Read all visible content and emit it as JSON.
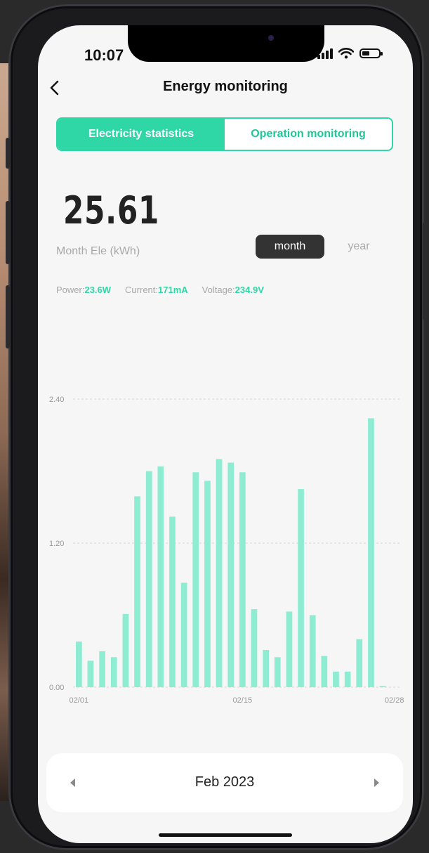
{
  "status": {
    "time": "10:07"
  },
  "header": {
    "title": "Energy monitoring",
    "back_icon": "chevron-left-icon"
  },
  "tabs": [
    {
      "label": "Electricity statistics",
      "active": true
    },
    {
      "label": "Operation monitoring",
      "active": false
    }
  ],
  "summary": {
    "value": "25.61",
    "unit_label": "Month Ele (kWh)"
  },
  "period": {
    "month_label": "month",
    "year_label": "year",
    "selected": "month"
  },
  "metrics": {
    "power_label": "Power:",
    "power_value": "23.6W",
    "current_label": "Current:",
    "current_value": "171mA",
    "voltage_label": "Voltage:",
    "voltage_value": "234.9V"
  },
  "footer": {
    "date": "Feb 2023"
  },
  "colors": {
    "accent": "#2fd6a6",
    "bar": "#8eecd2"
  },
  "chart_data": {
    "type": "bar",
    "title": "",
    "xlabel": "",
    "ylabel": "",
    "ylim": [
      0,
      2.4
    ],
    "y_ticks": [
      "0.00",
      "1.20",
      "2.40"
    ],
    "x_tick_labels": [
      "02/01",
      "02/15",
      "02/28"
    ],
    "categories": [
      "02/01",
      "02/02",
      "02/03",
      "02/04",
      "02/05",
      "02/06",
      "02/07",
      "02/08",
      "02/09",
      "02/10",
      "02/11",
      "02/12",
      "02/13",
      "02/14",
      "02/15",
      "02/16",
      "02/17",
      "02/18",
      "02/19",
      "02/20",
      "02/21",
      "02/22",
      "02/23",
      "02/24",
      "02/25",
      "02/26",
      "02/27",
      "02/28"
    ],
    "values": [
      0.38,
      0.22,
      0.3,
      0.25,
      0.61,
      1.59,
      1.8,
      1.84,
      1.42,
      0.87,
      1.79,
      1.72,
      1.9,
      1.87,
      1.79,
      0.65,
      0.31,
      0.25,
      0.63,
      1.65,
      0.6,
      0.26,
      0.13,
      0.13,
      0.4,
      2.24,
      0.01,
      0.0
    ],
    "grid": true
  }
}
